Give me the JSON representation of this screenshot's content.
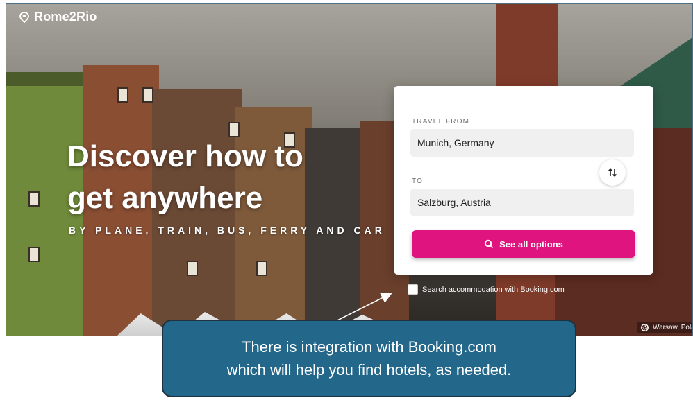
{
  "logo": {
    "text": "Rome2Rio",
    "icon": "rome2rio-logo-icon"
  },
  "hero": {
    "headline_line1": "Discover how to",
    "headline_line2": "get anywhere",
    "subline": "BY PLANE, TRAIN, BUS, FERRY AND CAR"
  },
  "search": {
    "from_label": "TRAVEL FROM",
    "from_value": "Munich, Germany",
    "to_label": "TO",
    "to_value": "Salzburg, Austria",
    "swap_icon": "swap-arrows-icon",
    "button_label": "See all options",
    "button_icon": "search-icon"
  },
  "booking": {
    "label": "Search accommodation with Booking.com",
    "checked": false
  },
  "location_tag": {
    "text": "Warsaw, Pola",
    "icon": "camera-shutter-icon"
  },
  "annotation": {
    "line1": "There is integration with Booking.com",
    "line2": "which will help you find hotels, as needed."
  },
  "colors": {
    "accent": "#e0147f",
    "callout": "#23678a"
  }
}
